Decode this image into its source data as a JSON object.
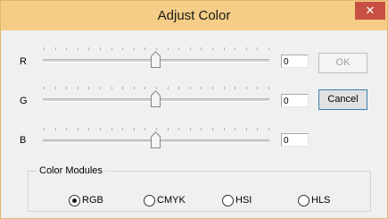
{
  "window": {
    "title": "Adjust Color",
    "close_label": "✕",
    "titlebar_color": "#f5cd86",
    "close_color": "#c74f43"
  },
  "sliders": [
    {
      "label": "R",
      "value": "0"
    },
    {
      "label": "G",
      "value": "0"
    },
    {
      "label": "B",
      "value": "0"
    }
  ],
  "buttons": {
    "ok_label": "OK",
    "ok_enabled": false,
    "cancel_label": "Cancel"
  },
  "color_modules": {
    "caption": "Color Modules",
    "options": [
      {
        "label": "RGB",
        "selected": true
      },
      {
        "label": "CMYK",
        "selected": false
      },
      {
        "label": "HSI",
        "selected": false
      },
      {
        "label": "HLS",
        "selected": false
      }
    ]
  }
}
